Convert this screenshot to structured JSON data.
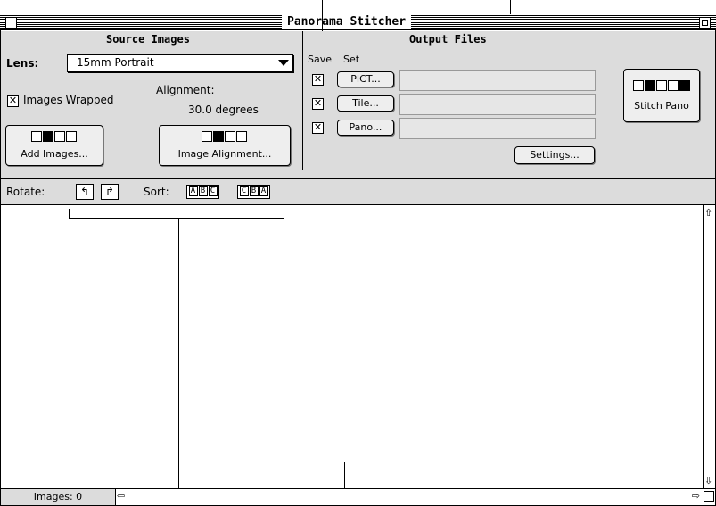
{
  "window": {
    "title": "Panorama Stitcher"
  },
  "source": {
    "title": "Source Images",
    "lens_label": "Lens:",
    "lens_value": "15mm Portrait",
    "images_wrapped_label": "Images Wrapped",
    "images_wrapped_checked": "✕",
    "alignment_label": "Alignment:",
    "alignment_value": "30.0 degrees",
    "add_images_label": "Add Images...",
    "image_alignment_label": "Image Alignment..."
  },
  "output": {
    "title": "Output Files",
    "save_header": "Save",
    "set_header": "Set",
    "rows": [
      {
        "checked": "✕",
        "button": "PICT..."
      },
      {
        "checked": "✕",
        "button": "Tile..."
      },
      {
        "checked": "✕",
        "button": "Pano..."
      }
    ],
    "settings_label": "Settings..."
  },
  "stitch": {
    "label": "Stitch Pano"
  },
  "toolbar": {
    "rotate_label": "Rotate:",
    "sort_label": "Sort:",
    "sort_abc": [
      "A",
      "B",
      "C"
    ],
    "sort_cba": [
      "C",
      "B",
      "A"
    ]
  },
  "status": {
    "images_count": "Images: 0"
  }
}
